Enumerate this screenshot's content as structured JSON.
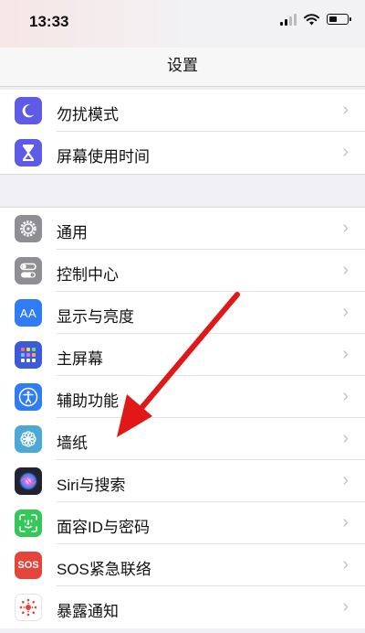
{
  "status": {
    "time": "13:33"
  },
  "nav": {
    "title": "设置"
  },
  "group1": [
    {
      "label": "勿扰模式",
      "icon": "moon-icon",
      "color": "#5e5ce6"
    },
    {
      "label": "屏幕使用时间",
      "icon": "hourglass-icon",
      "color": "#5e5ce6"
    }
  ],
  "group2": [
    {
      "label": "通用",
      "icon": "gear-icon",
      "color": "#8e8e93"
    },
    {
      "label": "控制中心",
      "icon": "toggle-switches-icon",
      "color": "#8e8e93"
    },
    {
      "label": "显示与亮度",
      "icon": "text-size-icon",
      "color": "#2f7cf6",
      "glyph": "AA"
    },
    {
      "label": "主屏幕",
      "icon": "home-screen-grid-icon",
      "color": "#3b5bdb"
    },
    {
      "label": "辅助功能",
      "icon": "accessibility-icon",
      "color": "#2f7cf6"
    },
    {
      "label": "墙纸",
      "icon": "flower-icon",
      "color": "#4aa9d6"
    },
    {
      "label": "Siri与搜索",
      "icon": "siri-icon",
      "color": "#222233"
    },
    {
      "label": "面容ID与密码",
      "icon": "face-id-icon",
      "color": "#34c759"
    },
    {
      "label": "SOS紧急联络",
      "icon": "sos-icon",
      "color": "#e5443a",
      "glyph": "SOS"
    },
    {
      "label": "暴露通知",
      "icon": "exposure-notification-icon",
      "color": "#ffffff"
    }
  ],
  "annotation": {
    "icon": "red-arrow-icon",
    "color": "#e01818"
  }
}
